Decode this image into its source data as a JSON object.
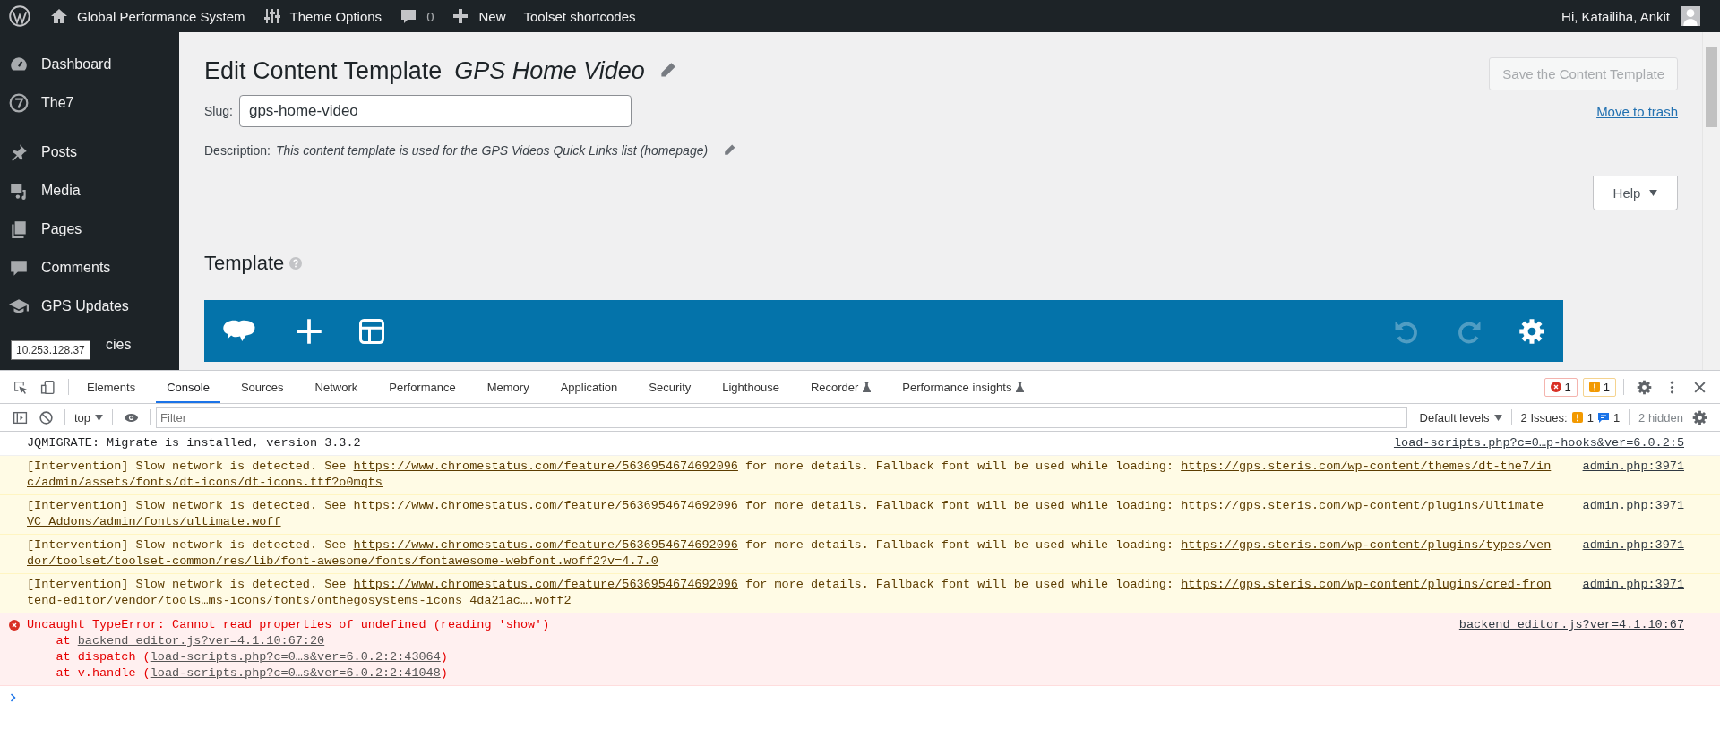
{
  "admin_bar": {
    "items": [
      {
        "kind": "logo"
      },
      {
        "kind": "home",
        "label": "Global Performance System"
      },
      {
        "kind": "sliders",
        "label": "Theme Options"
      },
      {
        "kind": "comments",
        "label": "0"
      },
      {
        "kind": "new",
        "label": "New"
      },
      {
        "kind": "text",
        "label": "Toolset shortcodes"
      }
    ],
    "greeting": "Hi, Katailiha, Ankit"
  },
  "sidebar": {
    "items": [
      {
        "kind": "dashboard",
        "label": "Dashboard"
      },
      {
        "kind": "seven",
        "label": "The7"
      },
      {
        "kind": "pin",
        "label": "Posts"
      },
      {
        "kind": "media",
        "label": "Media"
      },
      {
        "kind": "pages",
        "label": "Pages"
      },
      {
        "kind": "comment",
        "label": "Comments"
      },
      {
        "kind": "cap",
        "label": "GPS Updates"
      },
      {
        "label": "cies"
      }
    ],
    "tooltip": "10.253.128.37"
  },
  "page": {
    "title": "Edit Content Template",
    "template_name": "GPS Home Video",
    "slug_label": "Slug:",
    "slug": "gps-home-video",
    "description_label": "Description:",
    "description": "This content template is used for the GPS Videos Quick Links list (homepage)",
    "save_button": {
      "label": "Save the Content Template",
      "disabled": true
    },
    "trash_link": "Move to trash",
    "help_button": "Help",
    "section_title": "Template",
    "toolbar": [
      {
        "kind": "logo",
        "disabled": false
      },
      {
        "kind": "add",
        "disabled": false
      },
      {
        "kind": "layout",
        "disabled": false
      },
      {
        "kind": "undo",
        "disabled": true
      },
      {
        "kind": "redo",
        "disabled": true
      },
      {
        "kind": "settings",
        "disabled": false
      }
    ]
  },
  "devtools": {
    "tabs": [
      {
        "label": "Elements",
        "selected": false,
        "flask": false
      },
      {
        "label": "Console",
        "selected": true,
        "flask": false
      },
      {
        "label": "Sources",
        "selected": false,
        "flask": false
      },
      {
        "label": "Network",
        "selected": false,
        "flask": false
      },
      {
        "label": "Performance",
        "selected": false,
        "flask": false
      },
      {
        "label": "Memory",
        "selected": false,
        "flask": false
      },
      {
        "label": "Application",
        "selected": false,
        "flask": false
      },
      {
        "label": "Security",
        "selected": false,
        "flask": false
      },
      {
        "label": "Lighthouse",
        "selected": false,
        "flask": false
      },
      {
        "label": "Recorder",
        "selected": false,
        "flask": true
      },
      {
        "label": "Performance insights",
        "selected": false,
        "flask": true
      }
    ],
    "error_count": "1",
    "warning_count": "1",
    "filter": {
      "context": "top",
      "placeholder": "Filter",
      "levels": "Default levels",
      "issues_label": "2 Issues:",
      "issues": [
        {
          "kind": "warning",
          "count": "1"
        },
        {
          "kind": "info",
          "count": "1"
        }
      ],
      "hidden": "2 hidden"
    },
    "console": [
      {
        "kind": "log",
        "text": "JQMIGRATE: Migrate is installed, version 3.3.2",
        "source": "load-scripts.php?c=0…p-hooks&ver=6.0.2:5"
      },
      {
        "kind": "warning",
        "text": "[Intervention] Slow network is detected. See ",
        "link": "https://www.chromestatus.com/feature/5636954674692096",
        "text2": " for more details. Fallback font will be used while loading: ",
        "url": "https://gps.steris.com/wp-content/themes/dt-the7/in",
        "url_line2": "c/admin/assets/fonts/dt-icons/dt-icons.ttf?o0mqts",
        "source": "admin.php:3971"
      },
      {
        "kind": "warning",
        "text": "[Intervention] Slow network is detected. See ",
        "link": "https://www.chromestatus.com/feature/5636954674692096",
        "text2": " for more details. Fallback font will be used while loading: ",
        "url": "https://gps.steris.com/wp-content/plugins/Ultimate_",
        "url_line2": "VC_Addons/admin/fonts/ultimate.woff",
        "source": "admin.php:3971"
      },
      {
        "kind": "warning",
        "text": "[Intervention] Slow network is detected. See ",
        "link": "https://www.chromestatus.com/feature/5636954674692096",
        "text2": " for more details. Fallback font will be used while loading: ",
        "url": "https://gps.steris.com/wp-content/plugins/types/ven",
        "url_line2": "dor/toolset/toolset-common/res/lib/font-awesome/fonts/fontawesome-webfont.woff2?v=4.7.0",
        "source": "admin.php:3971"
      },
      {
        "kind": "warning",
        "text": "[Intervention] Slow network is detected. See ",
        "link": "https://www.chromestatus.com/feature/5636954674692096",
        "text2": " for more details. Fallback font will be used while loading: ",
        "url": "https://gps.steris.com/wp-content/plugins/cred-fron",
        "url_line2": "tend-editor/vendor/tools…ms-icons/fonts/onthegosystems-icons_4da21ac….woff2",
        "source": "admin.php:3971"
      },
      {
        "kind": "error",
        "text": "Uncaught TypeError: Cannot read properties of undefined (reading 'show')",
        "source": "backend_editor.js?ver=4.1.10:67",
        "stack": [
          {
            "before": "    at ",
            "link": "backend_editor.js?ver=4.1.10:67:20"
          },
          {
            "before": "    at dispatch (",
            "link": "load-scripts.php?c=0…s&ver=6.0.2:2:43064",
            "after": ")"
          },
          {
            "before": "    at v.handle (",
            "link": "load-scripts.php?c=0…s&ver=6.0.2:2:41048",
            "after": ")"
          }
        ]
      }
    ]
  }
}
